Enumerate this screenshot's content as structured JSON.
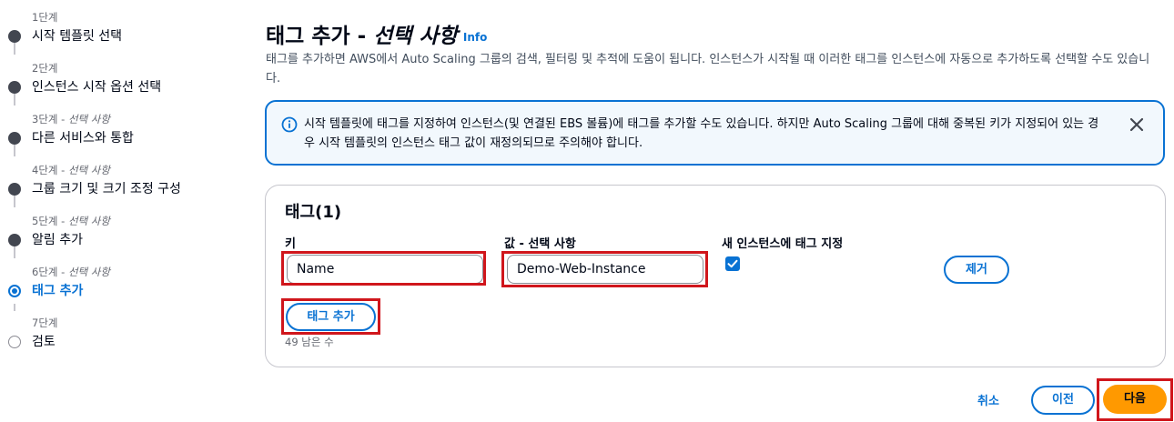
{
  "wizard": {
    "steps": [
      {
        "caption": "1단계",
        "optional": "",
        "label": "시작 템플릿 선택",
        "state": "done"
      },
      {
        "caption": "2단계",
        "optional": "",
        "label": "인스턴스 시작 옵션 선택",
        "state": "done"
      },
      {
        "caption": "3단계",
        "optional": "선택 사항",
        "label": "다른 서비스와 통합",
        "state": "done"
      },
      {
        "caption": "4단계",
        "optional": "선택 사항",
        "label": "그룹 크기 및 크기 조정 구성",
        "state": "done"
      },
      {
        "caption": "5단계",
        "optional": "선택 사항",
        "label": "알림 추가",
        "state": "done"
      },
      {
        "caption": "6단계",
        "optional": "선택 사항",
        "label": "태그 추가",
        "state": "current"
      },
      {
        "caption": "7단계",
        "optional": "",
        "label": "검토",
        "state": "todo"
      }
    ],
    "optional_separator": " - "
  },
  "header": {
    "title_main": "태그 추가 - ",
    "title_em": "선택 사항",
    "info_link": "Info",
    "description": "태그를 추가하면 AWS에서 Auto Scaling 그룹의 검색, 필터링 및 추적에 도움이 됩니다. 인스턴스가 시작될 때 이러한 태그를 인스턴스에 자동으로 추가하도록 선택할 수도 있습니다."
  },
  "alert": {
    "icon": "info-circle-icon",
    "text": "시작 템플릿에 태그를 지정하여 인스턴스(및 연결된 EBS 볼륨)에 태그를 추가할 수도 있습니다. 하지만 Auto Scaling 그룹에 대해 중복된 키가 지정되어 있는 경우 시작 템플릿의 인스턴스 태그 값이 재정의되므로 주의해야 합니다."
  },
  "tags": {
    "title": "태그(1)",
    "key_label": "키",
    "value_label": "값 - 선택 사항",
    "propagate_label": "새 인스턴스에 태그 지정",
    "rows": [
      {
        "key": "Name",
        "value": "Demo-Web-Instance",
        "propagate": true,
        "remove_label": "제거"
      }
    ],
    "add_button": "태그 추가",
    "remaining": "49 남은 수"
  },
  "footer": {
    "cancel": "취소",
    "previous": "이전",
    "next": "다음"
  },
  "colors": {
    "accent": "#0972d3",
    "primary": "#ff9900",
    "highlight": "#d0161c"
  }
}
